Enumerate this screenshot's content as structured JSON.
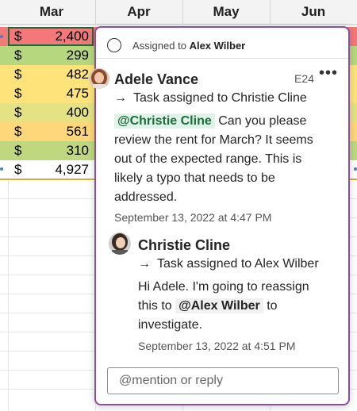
{
  "sheet": {
    "columns": [
      "Mar",
      "Apr",
      "May",
      "Jun"
    ],
    "rows": [
      {
        "symbol": "$",
        "value": "2,400",
        "color": "#f4787a"
      },
      {
        "symbol": "$",
        "value": "299",
        "color": "#b6d77d"
      },
      {
        "symbol": "$",
        "value": "482",
        "color": "#fde37a"
      },
      {
        "symbol": "$",
        "value": "475",
        "color": "#fde37a"
      },
      {
        "symbol": "$",
        "value": "400",
        "color": "#e5e283"
      },
      {
        "symbol": "$",
        "value": "561",
        "color": "#fdd77a"
      },
      {
        "symbol": "$",
        "value": "310",
        "color": "#bfd880"
      },
      {
        "symbol": "$",
        "value": "4,927",
        "color": "#ffffff"
      }
    ]
  },
  "card": {
    "assigned_prefix": "Assigned to",
    "assigned_name": "Alex Wilber",
    "comment": {
      "author": "Adele Vance",
      "cell_ref": "E24",
      "more_label": "•••",
      "task": "Task assigned to Christie Cline",
      "mention": "@Christie Cline",
      "text": "Can you please review the rent for March? It seems out of the expected range. This is likely a typo that needs to be addressed.",
      "timestamp": "September 13, 2022 at 4:47 PM"
    },
    "reply": {
      "author": "Christie Cline",
      "task": "Task assigned to Alex Wilber",
      "text_before": "Hi Adele. I'm going to reassign this to",
      "mention": "@Alex Wilber",
      "text_after": "to investigate.",
      "timestamp": "September 13, 2022 at 4:51 PM"
    },
    "reply_box": {
      "placeholder": "@mention or reply"
    }
  },
  "colors": {
    "accent_border": "#8a4f9e",
    "mention_bg": "#dff3e8",
    "selection": "#1e6b3a"
  }
}
